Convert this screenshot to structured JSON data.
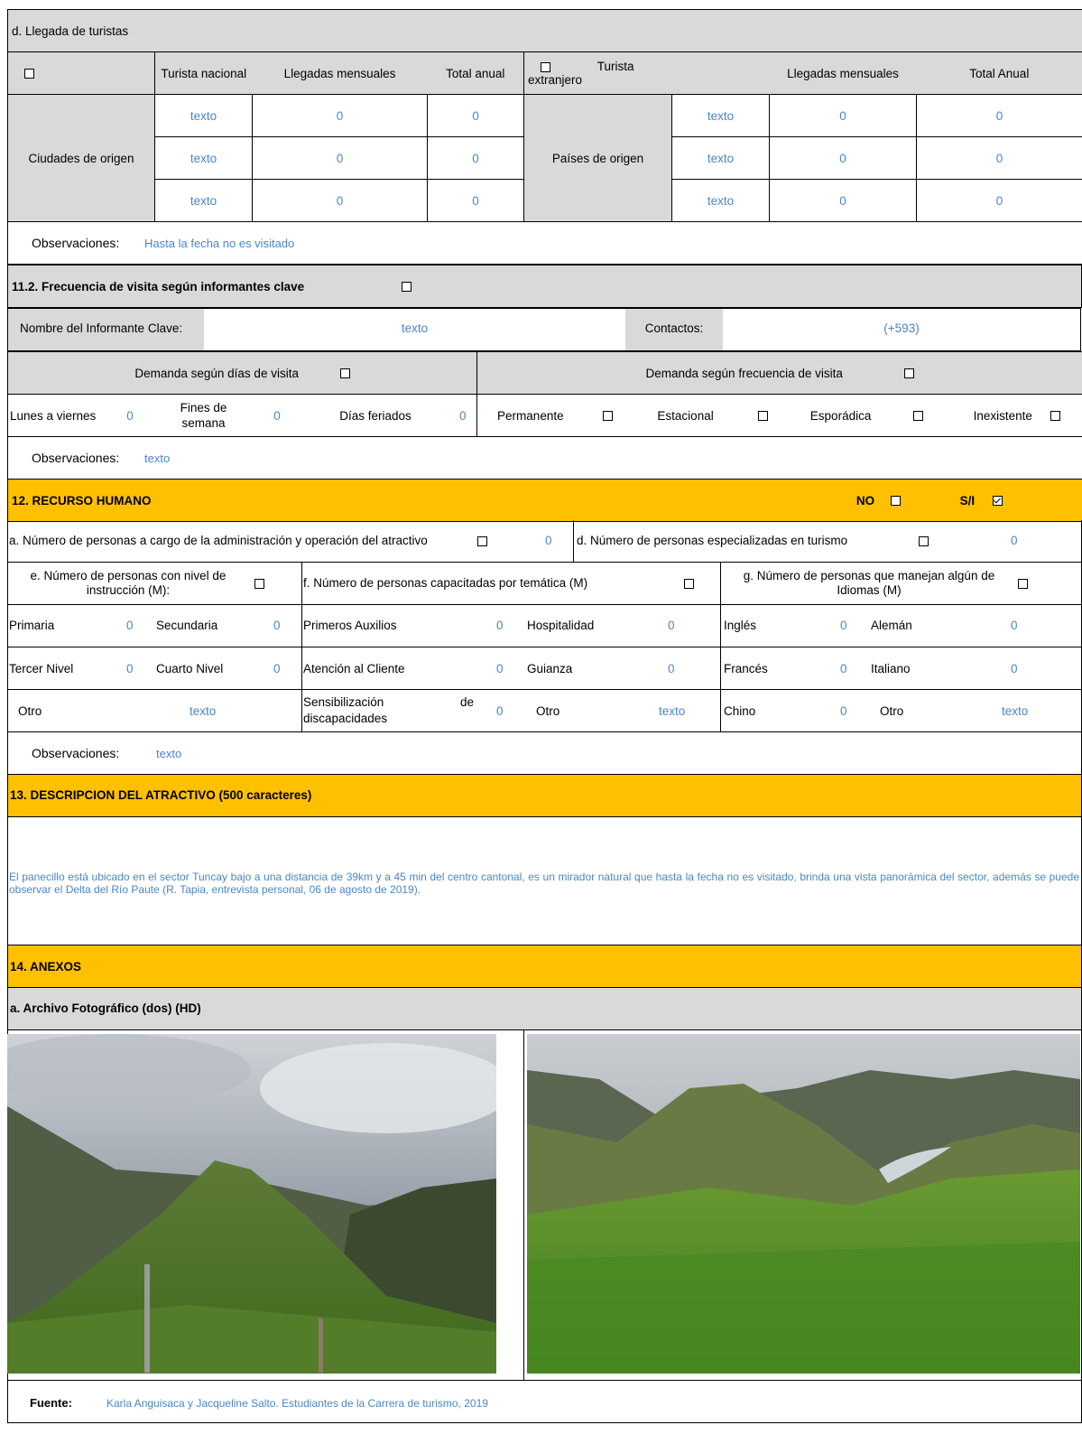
{
  "llegada": {
    "title": "d. Llegada de turistas",
    "nacional": {
      "label": "Turista nacional",
      "mensuales": "Llegadas mensuales",
      "total": "Total anual",
      "origen": "Ciudades de origen",
      "rows": [
        [
          "texto",
          "0",
          "0"
        ],
        [
          "texto",
          "0",
          "0"
        ],
        [
          "texto",
          "0",
          "0"
        ]
      ]
    },
    "extranjero": {
      "label": "Turista extranjero",
      "mensuales": "Llegadas mensuales",
      "total": "Total Anual",
      "origen": "Países de origen",
      "rows": [
        [
          "texto",
          "0",
          "0"
        ],
        [
          "texto",
          "0",
          "0"
        ],
        [
          "texto",
          "0",
          "0"
        ]
      ]
    },
    "obs_label": "Observaciones:",
    "obs_value": "Hasta la fecha no es visitado"
  },
  "frecuencia": {
    "title": "11.2. Frecuencia de visita según informantes clave",
    "informante_label": "Nombre del Informante Clave:",
    "informante_value": "texto",
    "contactos_label": "Contactos:",
    "contactos_value": "(+593)",
    "dias_title": "Demanda según  días de visita",
    "frec_title": "Demanda según frecuencia de visita",
    "lunes": "Lunes a viernes",
    "lunes_val": "0",
    "fines": "Fines de semana",
    "fines_val": "0",
    "feriados": "Días feriados",
    "feriados_val": "0",
    "permanente": "Permanente",
    "estacional": "Estacional",
    "esporadica": "Esporádica",
    "inexistente": "Inexistente",
    "obs_label": "Observaciones:",
    "obs_value": "texto"
  },
  "recurso": {
    "title": "12. RECURSO HUMANO",
    "si": "SI",
    "no": "NO",
    "si_n": "S/I",
    "a_label": "a. Número de personas a cargo de la administración y operación del atractivo",
    "a_val": "0",
    "d_label": "d. Número de personas especializadas en turismo",
    "d_val": "0",
    "e_label": "e. Número de personas con nivel de instrucción (M):",
    "f_label": "f. Número de personas capacitadas por temática (M)",
    "g_label": "g. Número de personas que manejan algún de Idiomas (M)",
    "primaria": "Primaria",
    "primaria_val": "0",
    "secundaria": "Secundaria",
    "secundaria_val": "0",
    "tercer": "Tercer Nivel",
    "tercer_val": "0",
    "cuarto": "Cuarto Nivel",
    "cuarto_val": "0",
    "otro1": "Otro",
    "otro1_val": "texto",
    "auxilios": "Primeros Auxilios",
    "auxilios_val": "0",
    "hospitalidad": "Hospitalidad",
    "hospitalidad_val": "0",
    "atencion": "Atención al Cliente",
    "atencion_val": "0",
    "guianza": "Guianza",
    "guianza_val": "0",
    "sensib_a": "Sensibilización",
    "sensib_de": "de",
    "sensib_b": "discapacidades",
    "sensib_val": "0",
    "otro2": "Otro",
    "otro2_val": "texto",
    "ingles": "Inglés",
    "ingles_val": "0",
    "aleman": "Alemán",
    "aleman_val": "0",
    "frances": "Francés",
    "frances_val": "0",
    "italiano": "Italiano",
    "italiano_val": "0",
    "chino": "Chino",
    "chino_val": "0",
    "otro3": "Otro",
    "otro3_val": "texto",
    "obs_label": "Observaciones:",
    "obs_value": "texto"
  },
  "descripcion": {
    "title": "13. DESCRIPCION DEL ATRACTIVO (500 caracteres)",
    "text": "El panecillo está ubicado en el sector Tuncay bajo a una distancia de 39km y a 45 min  del centro cantonal, es un mirador natural que hasta la fecha no es visitado, brinda una vista panorámica del sector, además se puede observar el Delta del Río Paute (R. Tapia, entrevista personal, 06 de agosto de 2019)."
  },
  "anexos": {
    "title": "14. ANEXOS",
    "archivo": "a. Archivo Fotográfico (dos) (HD)",
    "fuente_label": "Fuente:",
    "fuente_value": "Karla Anguisaca y Jacqueline Salto. Estudiantes de la Carrera de turismo, 2019"
  },
  "colors": {
    "header_orange": "#ffc000",
    "header_gray": "#d9d9d9",
    "value_blue": "#4a86c5"
  }
}
